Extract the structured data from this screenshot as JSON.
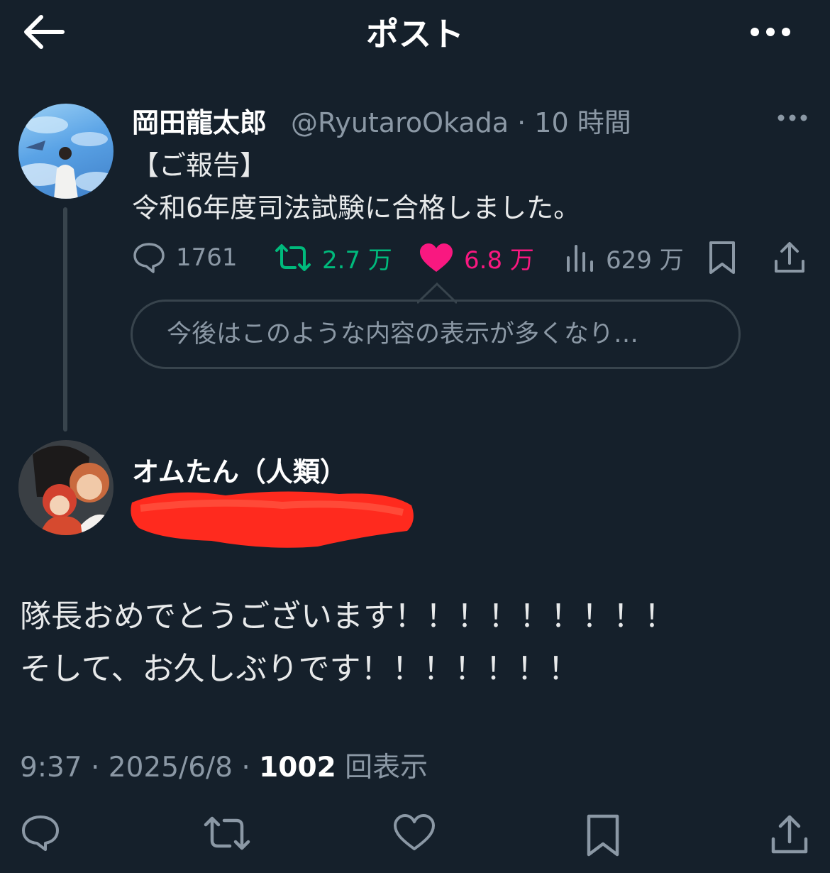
{
  "header": {
    "title": "ポスト",
    "back_icon": "arrow-left-icon",
    "more_icon": "more-horizontal-icon"
  },
  "original_post": {
    "display_name": "岡田龍太郎",
    "handle_time": "@RyutaroOkada · 10 時間",
    "lines": [
      "【ご報告】",
      "令和6年度司法試験に合格しました。"
    ],
    "actions": {
      "reply_count": "1761",
      "repost_count": "2.7 万",
      "like_count": "6.8 万",
      "view_count": "629 万"
    },
    "suggestion_text": "今後はこのような内容の表示が多くなり…",
    "colors": {
      "repost": "#00ba7c",
      "like": "#f91880",
      "muted": "#8b98a5"
    }
  },
  "reply_post": {
    "display_name": "オムたん（人類）",
    "handle_redacted": true,
    "lines": [
      "隊長おめでとうございます！！！！！！！！！",
      "そして、お久しぶりです！！！！！！！"
    ],
    "meta": {
      "time": "9:37",
      "date": "2025/6/8",
      "views_count": "1002",
      "views_label": "回表示"
    }
  },
  "bottom_bar": [
    "reply-icon",
    "repost-icon",
    "like-icon",
    "bookmark-icon",
    "share-icon"
  ]
}
